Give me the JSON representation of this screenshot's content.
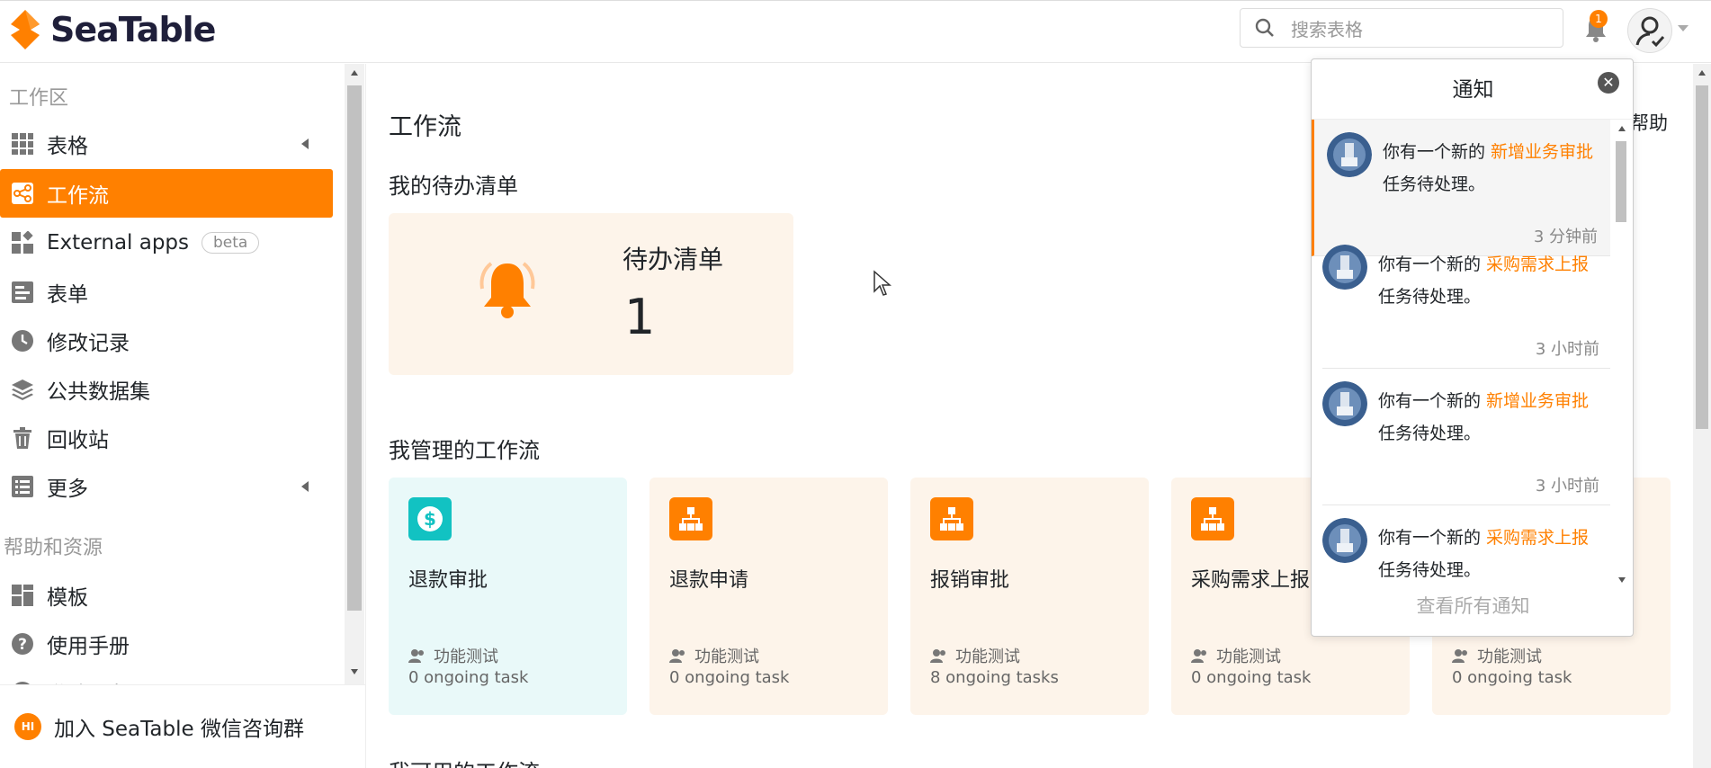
{
  "app": {
    "logo_text": "SeaTable"
  },
  "header": {
    "search_placeholder": "搜索表格",
    "notification_count": "1"
  },
  "sidebar": {
    "workspace_title": "工作区",
    "items": [
      {
        "label": "表格",
        "icon": "grid-icon"
      },
      {
        "label": "工作流",
        "icon": "workflow-icon"
      },
      {
        "label": "External apps",
        "badge": "beta",
        "icon": "apps-icon"
      },
      {
        "label": "表单",
        "icon": "form-icon"
      },
      {
        "label": "修改记录",
        "icon": "clock-icon"
      },
      {
        "label": "公共数据集",
        "icon": "layers-icon"
      },
      {
        "label": "回收站",
        "icon": "trash-icon"
      },
      {
        "label": "更多",
        "icon": "list-icon"
      }
    ],
    "help_title": "帮助和资源",
    "help_items": [
      {
        "label": "模板",
        "icon": "template-icon"
      },
      {
        "label": "使用手册",
        "icon": "question-icon"
      },
      {
        "label": "邀请朋友",
        "icon": "invite-icon"
      }
    ],
    "footer_label": "加入 SeaTable 微信咨询群",
    "footer_icon_text": "HI"
  },
  "main": {
    "page_title": "工作流",
    "help_label": "帮助",
    "todo_section": "我的待办清单",
    "todo_card": {
      "label": "待办清单",
      "count": "1"
    },
    "managed_section": "我管理的工作流",
    "workflows": [
      {
        "name": "退款审批",
        "owner": "功能测试",
        "tasks": "0 ongoing task",
        "color": "teal"
      },
      {
        "name": "退款申请",
        "owner": "功能测试",
        "tasks": "0 ongoing task",
        "color": "orange"
      },
      {
        "name": "报销审批",
        "owner": "功能测试",
        "tasks": "8 ongoing tasks",
        "color": "orange"
      },
      {
        "name": "采购需求上报",
        "owner": "功能测试",
        "tasks": "0 ongoing task",
        "color": "orange"
      },
      {
        "name": "",
        "owner": "功能测试",
        "tasks": "0 ongoing task",
        "color": "orange"
      }
    ],
    "usable_section": "我可用的工作流"
  },
  "notifications": {
    "title": "通知",
    "footer": "查看所有通知",
    "items": [
      {
        "prefix": "你有一个新的 ",
        "link": "新增业务审批",
        "suffix": "任务待处理。",
        "time": "3 分钟前",
        "unread": true
      },
      {
        "prefix": "你有一个新的 ",
        "link": "采购需求上报",
        "suffix": "任务待处理。",
        "time": "3 小时前",
        "unread": false
      },
      {
        "prefix": "你有一个新的 ",
        "link": "新增业务审批",
        "suffix": "任务待处理。",
        "time": "3 小时前",
        "unread": false
      },
      {
        "prefix": "你有一个新的 ",
        "link": "采购需求上报",
        "suffix": "任务待处理。",
        "time": "",
        "unread": false
      }
    ]
  },
  "colors": {
    "accent": "#ff8000",
    "teal": "#12c2c2",
    "card_bg": "#fdf4ea",
    "teal_bg": "#e9f9f9"
  }
}
